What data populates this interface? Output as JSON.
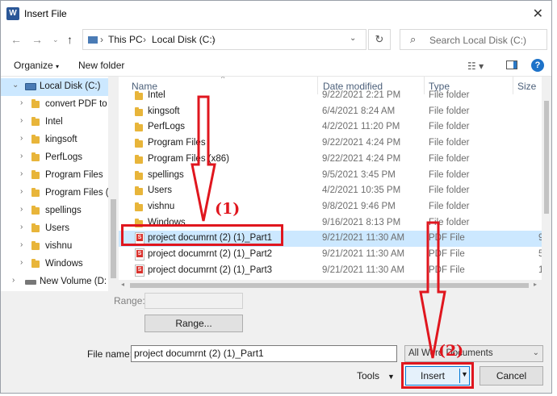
{
  "window": {
    "title": "Insert File",
    "app_icon": "W"
  },
  "nav": {
    "breadcrumb": [
      "This PC",
      "Local Disk (C:)"
    ],
    "search_placeholder": "Search Local Disk (C:)"
  },
  "toolbar": {
    "organize": "Organize",
    "new_folder": "New folder",
    "help": "?"
  },
  "tree": [
    {
      "label": "Local Disk (C:)",
      "kind": "drive"
    },
    {
      "label": "convert PDF to",
      "kind": "folder"
    },
    {
      "label": "Intel",
      "kind": "folder"
    },
    {
      "label": "kingsoft",
      "kind": "folder"
    },
    {
      "label": "PerfLogs",
      "kind": "folder"
    },
    {
      "label": "Program Files",
      "kind": "folder"
    },
    {
      "label": "Program Files (",
      "kind": "folder"
    },
    {
      "label": "spellings",
      "kind": "folder"
    },
    {
      "label": "Users",
      "kind": "folder"
    },
    {
      "label": "vishnu",
      "kind": "folder"
    },
    {
      "label": "Windows",
      "kind": "folder"
    },
    {
      "label": "New Volume (D:",
      "kind": "hdd"
    }
  ],
  "columns": {
    "name": "Name",
    "date": "Date modified",
    "type": "Type",
    "size": "Size"
  },
  "files": [
    {
      "name": "Intel",
      "date": "9/22/2021 2:21 PM",
      "type": "File folder",
      "size": "",
      "kind": "folder"
    },
    {
      "name": "kingsoft",
      "date": "6/4/2021 8:24 AM",
      "type": "File folder",
      "size": "",
      "kind": "folder"
    },
    {
      "name": "PerfLogs",
      "date": "4/2/2021 11:20 PM",
      "type": "File folder",
      "size": "",
      "kind": "folder"
    },
    {
      "name": "Program Files",
      "date": "9/22/2021 4:24 PM",
      "type": "File folder",
      "size": "",
      "kind": "folder"
    },
    {
      "name": "Program Files (x86)",
      "date": "9/22/2021 4:24 PM",
      "type": "File folder",
      "size": "",
      "kind": "folder"
    },
    {
      "name": "spellings",
      "date": "9/5/2021 3:45 PM",
      "type": "File folder",
      "size": "",
      "kind": "folder"
    },
    {
      "name": "Users",
      "date": "4/2/2021 10:35 PM",
      "type": "File folder",
      "size": "",
      "kind": "folder"
    },
    {
      "name": "vishnu",
      "date": "9/8/2021 9:46 PM",
      "type": "File folder",
      "size": "",
      "kind": "folder"
    },
    {
      "name": "Windows",
      "date": "9/16/2021 8:13 PM",
      "type": "File folder",
      "size": "",
      "kind": "folder"
    },
    {
      "name": "project documrnt (2) (1)_Part1",
      "date": "9/21/2021 11:30 AM",
      "type": "PDF File",
      "size": "9",
      "kind": "pdf",
      "selected": true
    },
    {
      "name": "project documrnt (2) (1)_Part2",
      "date": "9/21/2021 11:30 AM",
      "type": "PDF File",
      "size": "5",
      "kind": "pdf"
    },
    {
      "name": "project documrnt (2) (1)_Part3",
      "date": "9/21/2021 11:30 AM",
      "type": "PDF File",
      "size": "1",
      "kind": "pdf"
    }
  ],
  "range": {
    "label": "Range:",
    "button": "Range..."
  },
  "footer": {
    "file_name_label": "File name:",
    "file_name_value": "project documrnt (2) (1)_Part1",
    "file_type": "All Word Documents",
    "tools": "Tools",
    "insert": "Insert",
    "cancel": "Cancel"
  },
  "annotations": {
    "step1": "(1)",
    "step2": "(2)",
    "color": "#e0161e"
  }
}
